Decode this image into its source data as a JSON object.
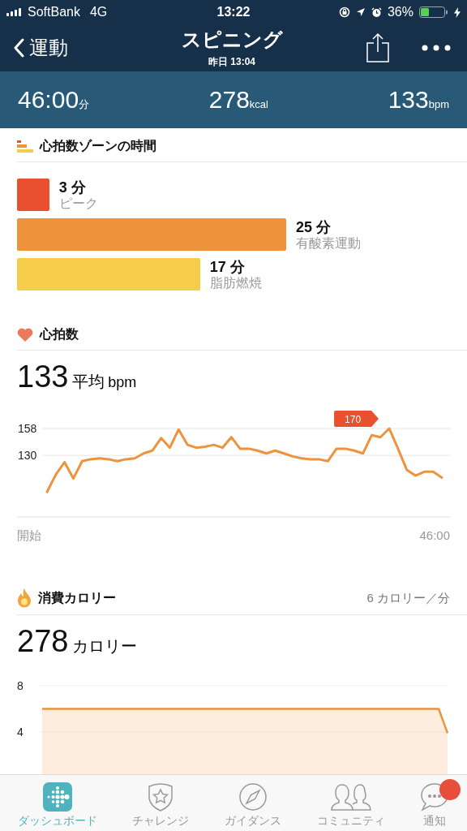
{
  "status_bar": {
    "carrier": "SoftBank",
    "network": "4G",
    "time": "13:22",
    "battery": "36%"
  },
  "nav": {
    "back": "運動",
    "title": "スピニング",
    "subtitle": "昨日 13:04"
  },
  "summary": [
    {
      "value": "46:00",
      "unit": "分"
    },
    {
      "value": "278",
      "unit": "kcal"
    },
    {
      "value": "133",
      "unit": "bpm"
    }
  ],
  "zones": {
    "title": "心拍数ゾーンの時間",
    "items": [
      {
        "minutes": "3 分",
        "label": "ピーク",
        "color": "#e9502f"
      },
      {
        "minutes": "25 分",
        "label": "有酸素運動",
        "color": "#ee923b"
      },
      {
        "minutes": "17 分",
        "label": "脂肪燃焼",
        "color": "#f6cc4b"
      }
    ]
  },
  "heart_rate": {
    "title": "心拍数",
    "value": "133",
    "value_label": "平均",
    "unit": "bpm",
    "peak_label": "170",
    "axis_start": "開始",
    "axis_end": "46:00",
    "chart_data": {
      "type": "line",
      "ylim": [
        66,
        158
      ],
      "yticks": [
        130,
        158
      ],
      "series": [
        {
          "color": "#ee923b",
          "values": [
            92,
            110,
            123,
            106,
            124,
            126,
            127,
            126,
            124,
            126,
            127,
            132,
            135,
            148,
            138,
            157,
            141,
            138,
            139,
            141,
            138,
            149,
            137,
            137,
            135,
            132,
            135,
            132,
            129,
            127,
            126,
            126,
            124,
            137,
            137,
            135,
            132,
            151,
            149,
            158,
            137,
            115,
            109,
            113,
            113,
            107
          ]
        }
      ]
    }
  },
  "calories": {
    "title": "消費カロリー",
    "rate": "6 カロリー／分",
    "value": "278",
    "unit": "カロリー",
    "chart_data": {
      "type": "area",
      "ylim": [
        0,
        8
      ],
      "yticks": [
        4,
        8
      ],
      "series": [
        {
          "color": "#ee923b",
          "values": [
            6,
            6,
            6,
            6,
            6,
            6,
            6,
            6,
            6,
            6,
            6,
            6,
            6,
            6,
            6,
            6,
            6,
            6,
            6,
            6,
            6,
            6,
            6,
            6,
            6,
            6,
            6,
            6,
            6,
            6,
            6,
            6,
            6,
            6,
            6,
            6,
            6,
            6,
            6,
            6,
            6,
            6,
            6,
            6,
            6,
            6,
            3.9
          ]
        }
      ]
    }
  },
  "tabs": [
    {
      "label": "ダッシュボード",
      "selected": true,
      "badge": false
    },
    {
      "label": "チャレンジ",
      "selected": false,
      "badge": false
    },
    {
      "label": "ガイダンス",
      "selected": false,
      "badge": false
    },
    {
      "label": "コミュニティ",
      "selected": false,
      "badge": false
    },
    {
      "label": "通知",
      "selected": false,
      "badge": true
    }
  ]
}
